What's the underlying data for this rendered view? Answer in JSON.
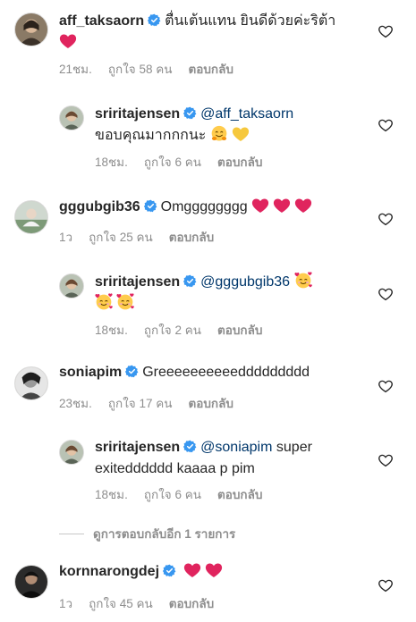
{
  "comments": [
    {
      "username": "aff_taksaorn",
      "text": "ตื่นเต้นแทน ยินดีด้วยค่ะริต้า",
      "emojis_after": [
        "red-heart"
      ],
      "time": "21ชม.",
      "likes": "ถูกใจ 58 คน",
      "reply": "ตอบกลับ"
    },
    {
      "username": "sriritajensen",
      "mention": "@aff_taksaorn",
      "text": "ขอบคุณมากกกนะ",
      "emojis_after": [
        "hugging-face",
        "yellow-heart"
      ],
      "time": "18ชม.",
      "likes": "ถูกใจ 6 คน",
      "reply": "ตอบกลับ"
    },
    {
      "username": "gggubgib36",
      "text": "Omgggggggg",
      "emojis_after": [
        "red-heart",
        "red-heart",
        "red-heart"
      ],
      "time": "1ว",
      "likes": "ถูกใจ 25 คน",
      "reply": "ตอบกลับ"
    },
    {
      "username": "sriritajensen",
      "mention": "@gggubgib36",
      "text": "",
      "emojis_after": [
        "smiling-face-with-hearts",
        "smiling-face-with-hearts",
        "smiling-face-with-hearts"
      ],
      "time": "18ชม.",
      "likes": "ถูกใจ 2 คน",
      "reply": "ตอบกลับ"
    },
    {
      "username": "soniapim",
      "text": "Greeeeeeeeeeddddddddd",
      "emojis_after": [],
      "time": "23ชม.",
      "likes": "ถูกใจ 17 คน",
      "reply": "ตอบกลับ"
    },
    {
      "username": "sriritajensen",
      "mention": "@soniapim",
      "text": "super exitedddddd kaaaa p pim",
      "emojis_after": [],
      "time": "18ชม.",
      "likes": "ถูกใจ 6 คน",
      "reply": "ตอบกลับ"
    },
    {
      "username": "kornnarongdej",
      "text": "",
      "emojis_after": [
        "red-heart",
        "red-heart"
      ],
      "time": "1ว",
      "likes": "ถูกใจ 45 คน",
      "reply": "ตอบกลับ"
    }
  ],
  "view_more_replies": "ดูการตอบกลับอีก 1 รายการ",
  "colors": {
    "verified_blue": "#3897f0",
    "meta_gray": "#8e8e8e",
    "mention_blue": "#00376b",
    "heart_red": "#e0245e"
  }
}
